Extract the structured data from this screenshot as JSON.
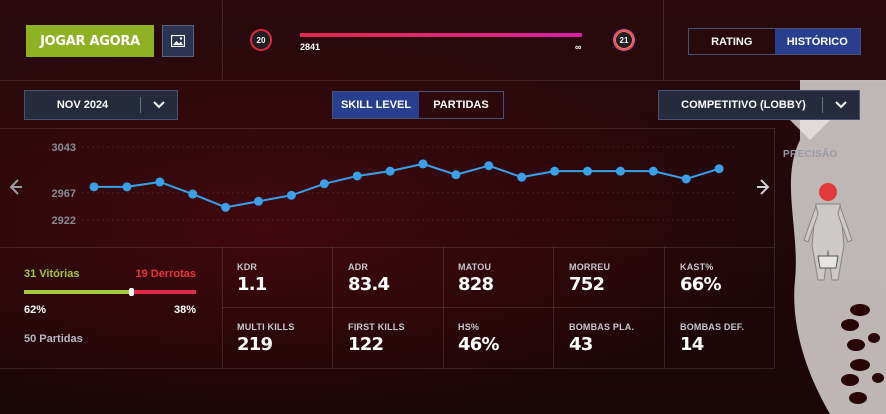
{
  "header": {
    "play_button": "JOGAR AGORA",
    "image_button_icon": "image-icon",
    "current_level": "20",
    "next_level": "21",
    "progress_value": "2841",
    "progress_max": "∞",
    "progress_fraction": 1.0,
    "rating_tabs": [
      {
        "label": "RATING",
        "active": false
      },
      {
        "label": "HISTÓRICO",
        "active": true
      }
    ]
  },
  "filters": {
    "month": "NOV 2024",
    "mode_tabs": [
      {
        "label": "SKILL LEVEL",
        "active": true
      },
      {
        "label": "PARTIDAS",
        "active": false
      }
    ],
    "queue": "COMPETITIVO (LOBBY)"
  },
  "chart_data": {
    "type": "line",
    "y_ticks": [
      "3043",
      "2967",
      "2922"
    ],
    "ylim": [
      2922,
      3043
    ],
    "values": [
      2977,
      2977,
      2985,
      2965,
      2943,
      2953,
      2963,
      2982,
      2995,
      3003,
      3015,
      2997,
      3012,
      2993,
      3003,
      3003,
      3003,
      3003,
      2990,
      3007
    ],
    "color": "#3aa0ea",
    "grid": true
  },
  "side": {
    "precision_label": "PRECISÃO"
  },
  "record": {
    "wins": "31 Vitórias",
    "losses": "19 Derrotas",
    "win_pct": "62%",
    "loss_pct": "38%",
    "win_fraction": 0.62,
    "games": "50 Partidas",
    "win_color": "#a4c93a",
    "loss_color": "#e8343c"
  },
  "stats": [
    {
      "label": "KDR",
      "value": "1.1"
    },
    {
      "label": "ADR",
      "value": "83.4"
    },
    {
      "label": "MATOU",
      "value": "828"
    },
    {
      "label": "MORREU",
      "value": "752"
    },
    {
      "label": "KAST%",
      "value": "66%"
    },
    {
      "label": "MULTI KILLS",
      "value": "219"
    },
    {
      "label": "FIRST KILLS",
      "value": "122"
    },
    {
      "label": "HS%",
      "value": "46%"
    },
    {
      "label": "BOMBAS PLA.",
      "value": "43"
    },
    {
      "label": "BOMBAS DEF.",
      "value": "14"
    }
  ]
}
